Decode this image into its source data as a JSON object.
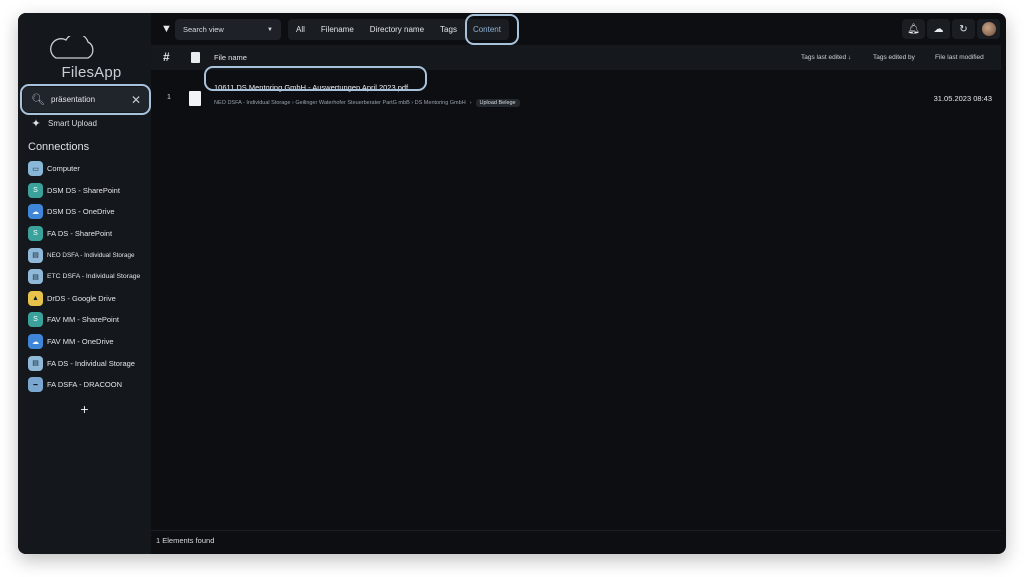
{
  "app": {
    "name": "FilesApp"
  },
  "sidebar": {
    "search": {
      "value": "präsentation",
      "clear": "✕"
    },
    "smart_upload": "Smart Upload",
    "connections_title": "Connections",
    "connections": [
      {
        "label": "Computer",
        "icon": "computer-icon"
      },
      {
        "label": "DSM DS - SharePoint",
        "icon": "sharepoint-icon"
      },
      {
        "label": "DSM DS - OneDrive",
        "icon": "onedrive-icon"
      },
      {
        "label": "FA DS - SharePoint",
        "icon": "sharepoint-icon"
      },
      {
        "label": "NEO DSFA - Individual Storage",
        "icon": "storage-icon"
      },
      {
        "label": "ETC DSFA - Individual Storage",
        "icon": "storage-icon"
      },
      {
        "label": "DrDS - Google Drive",
        "icon": "google-drive-icon"
      },
      {
        "label": "FAV MM - SharePoint",
        "icon": "sharepoint-icon"
      },
      {
        "label": "FAV MM - OneDrive",
        "icon": "onedrive-icon"
      },
      {
        "label": "FA DS - Individual Storage",
        "icon": "storage-icon"
      },
      {
        "label": "FA DSFA - DRACOON",
        "icon": "dracoon-icon"
      }
    ],
    "add": "+"
  },
  "toolbar": {
    "view_select": "Search view",
    "tabs": [
      "All",
      "Filename",
      "Directory name",
      "Tags",
      "Content"
    ],
    "active_tab": "Content"
  },
  "table": {
    "columns": {
      "hash": "#",
      "file_name": "File name",
      "tags_last_edited": "Tags last edited",
      "tags_edited_by": "Tags edited by",
      "file_last_modified": "File last modified"
    },
    "rows": [
      {
        "num": "1",
        "file_name": "10611 DS Mentoring GmbH - Auswertungen April 2023.pdf",
        "path_text": "NEO DSFA - Individual Storage › Geilinger Waterhofer Steuerberater PartG mbB › DS Mentoring GmbH",
        "path_last": "Upload Belege",
        "modified": "31.05.2023 08:43"
      }
    ]
  },
  "status": {
    "text": "1 Elements found"
  },
  "colors": {
    "accent": "#a9c2dc",
    "background": "#0c0e12",
    "sidebar": "#14171c"
  }
}
